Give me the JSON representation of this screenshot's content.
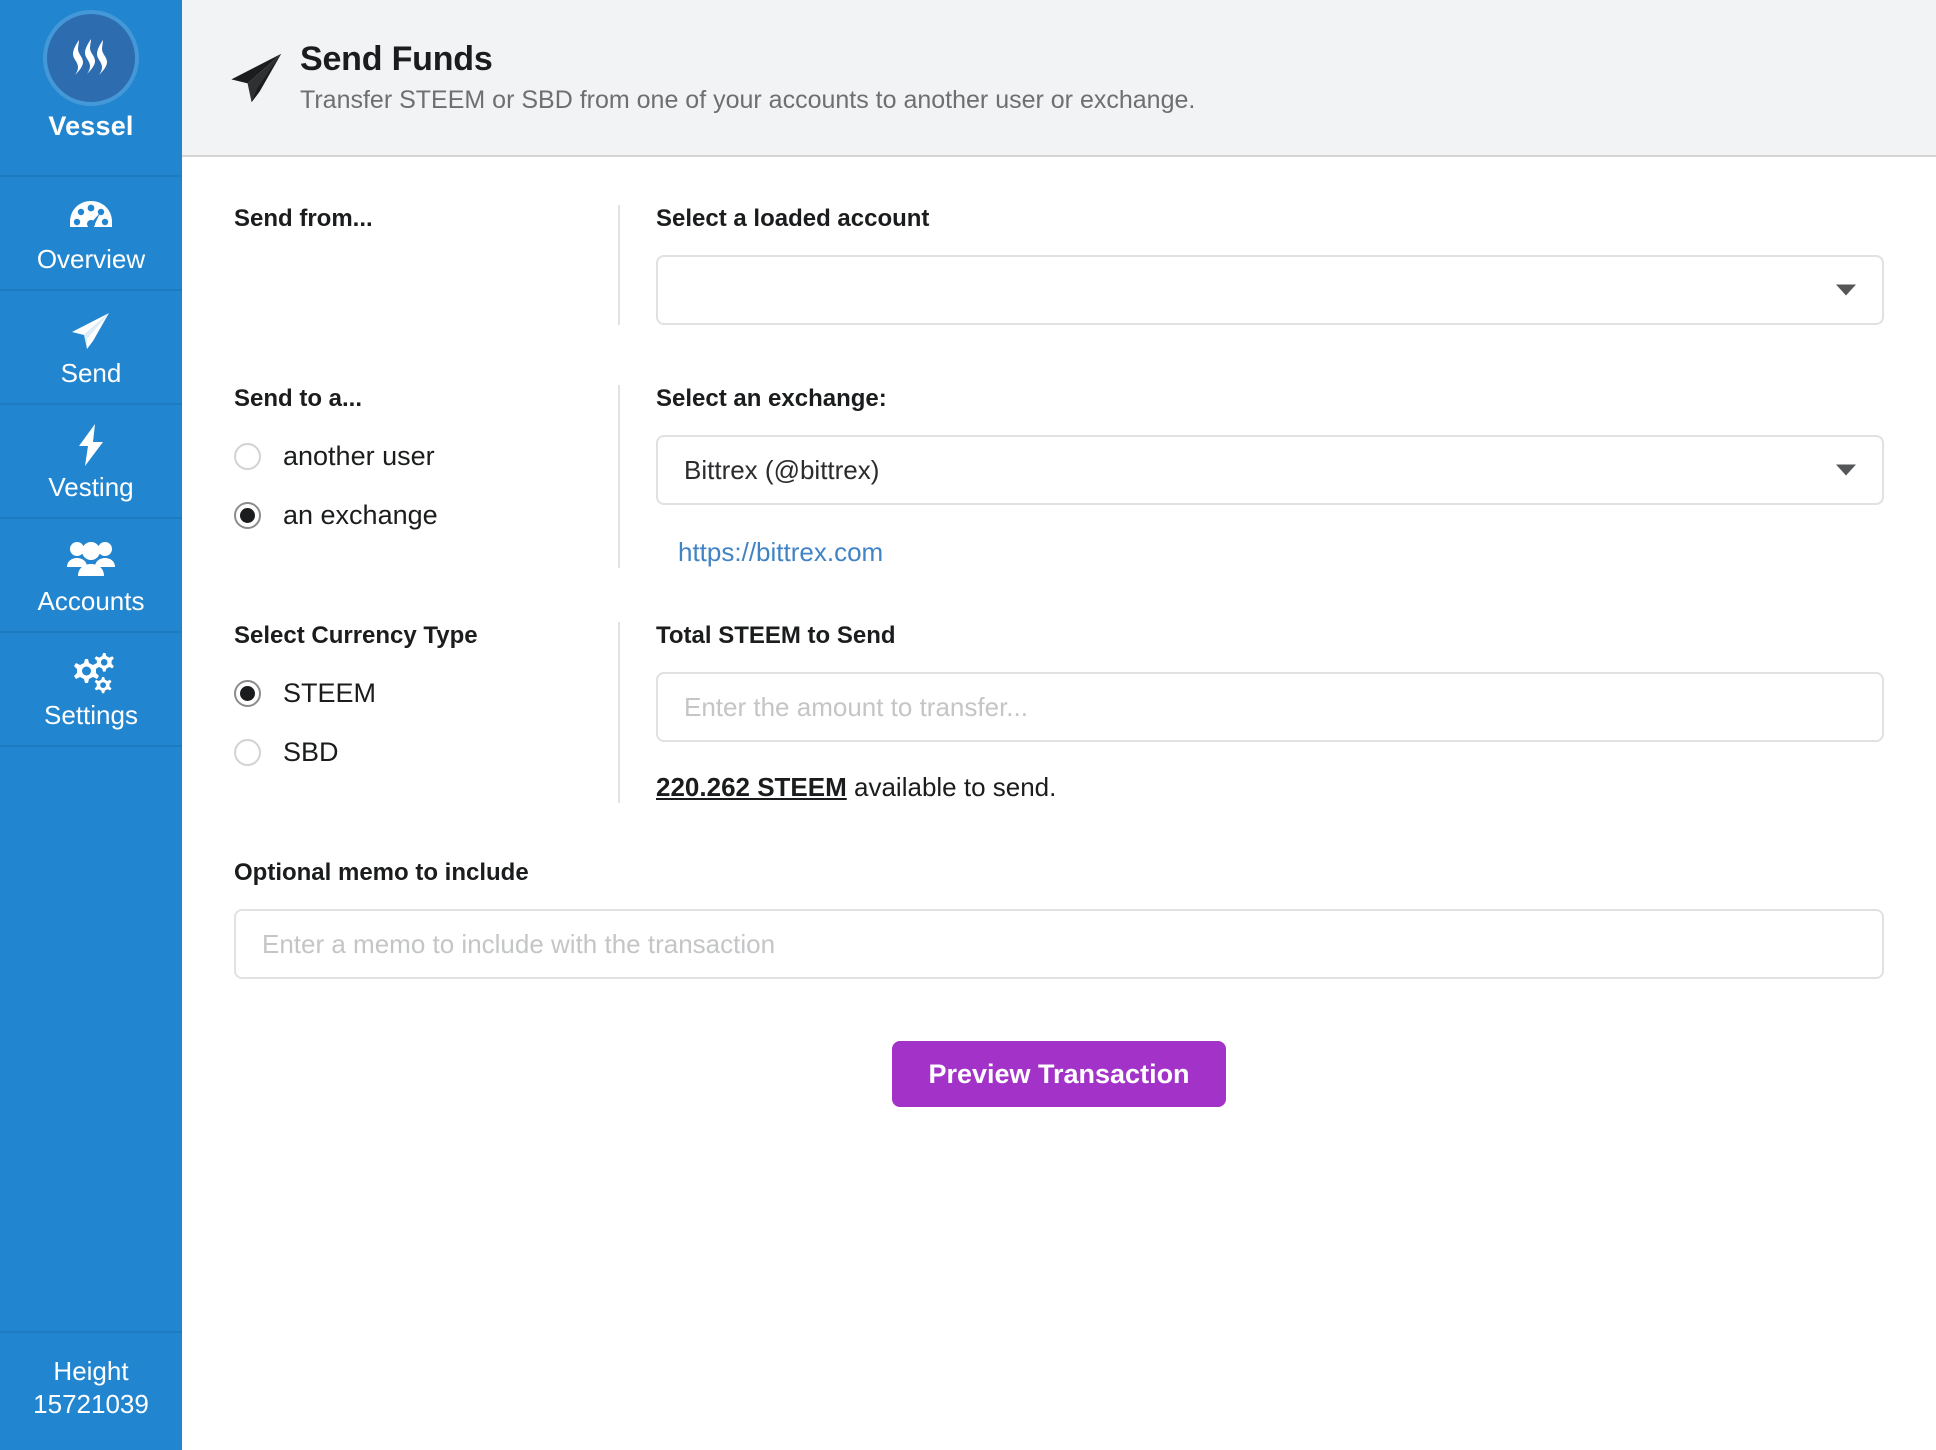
{
  "sidebar": {
    "brand": {
      "name": "Vessel",
      "logo_icon": "steem-logo-icon"
    },
    "items": [
      {
        "label": "Overview",
        "icon": "tachometer-icon",
        "active": false
      },
      {
        "label": "Send",
        "icon": "paper-plane-icon",
        "active": true
      },
      {
        "label": "Vesting",
        "icon": "lightning-bolt-icon",
        "active": false
      },
      {
        "label": "Accounts",
        "icon": "users-group-icon",
        "active": false
      },
      {
        "label": "Settings",
        "icon": "gears-icon",
        "active": false
      }
    ],
    "status": {
      "height_label": "Height",
      "height_value": "15721039"
    }
  },
  "header": {
    "icon": "paper-plane-icon",
    "title": "Send Funds",
    "subtitle": "Transfer STEEM or SBD from one of your accounts to another user or exchange."
  },
  "form": {
    "send_from": {
      "section_label": "Send from...",
      "field_label": "Select a loaded account",
      "selected_value": "",
      "caret_icon": "chevron-down-icon"
    },
    "send_to": {
      "section_label": "Send to a...",
      "options": [
        {
          "label": "another user",
          "selected": false
        },
        {
          "label": "an exchange",
          "selected": true
        }
      ],
      "exchange_label": "Select an exchange:",
      "exchange_selected": "Bittrex (@bittrex)",
      "exchange_url": "https://bittrex.com",
      "caret_icon": "chevron-down-icon"
    },
    "currency": {
      "section_label": "Select Currency Type",
      "options": [
        {
          "label": "STEEM",
          "selected": true
        },
        {
          "label": "SBD",
          "selected": false
        }
      ],
      "amount_label": "Total STEEM to Send",
      "amount_value": "",
      "amount_placeholder": "Enter the amount to transfer...",
      "available_amount": "220.262 STEEM",
      "available_suffix": " available to send."
    },
    "memo": {
      "label": "Optional memo to include",
      "value": "",
      "placeholder": "Enter a memo to include with the transaction"
    },
    "submit_label": "Preview Transaction"
  },
  "colors": {
    "sidebar": "#2185d0",
    "brand_circle": "#2d6cae",
    "header_bg": "#f2f3f4",
    "primary_button": "#a333c8",
    "link": "#4183c4"
  }
}
